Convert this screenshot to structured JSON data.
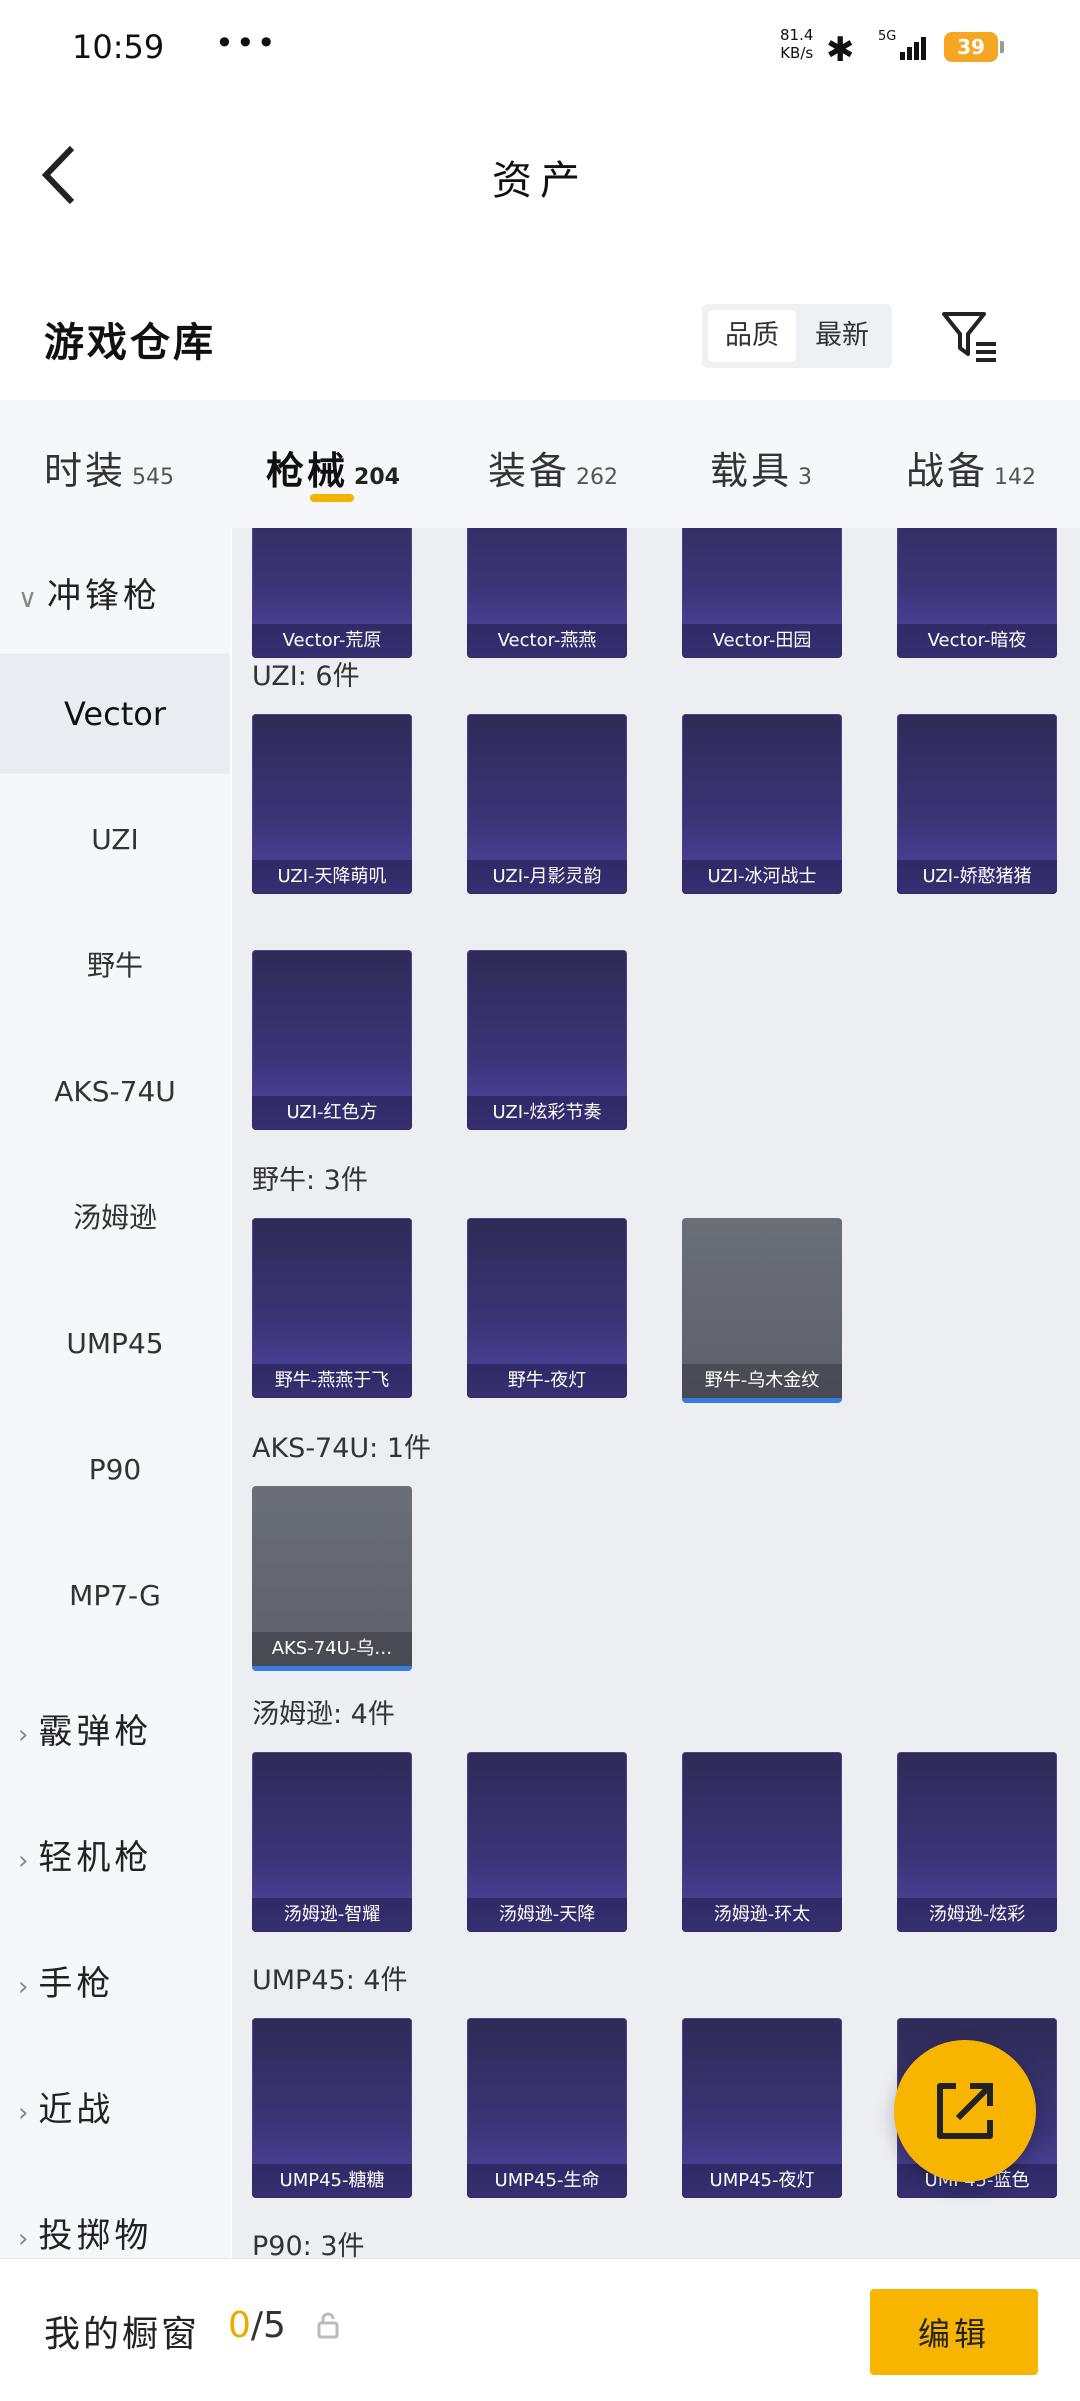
{
  "status_bar": {
    "time": "10:59",
    "net_speed": "81.4",
    "net_unit": "KB/s",
    "signal": "5G",
    "battery": "39"
  },
  "header": {
    "title": "资产"
  },
  "section": {
    "title": "游戏仓库",
    "sort_options": [
      "品质",
      "最新"
    ],
    "active_sort": "品质"
  },
  "tabs": [
    {
      "label": "时装",
      "count": "545"
    },
    {
      "label": "枪械",
      "count": "204"
    },
    {
      "label": "装备",
      "count": "262"
    },
    {
      "label": "载具",
      "count": "3"
    },
    {
      "label": "战备",
      "count": "142"
    }
  ],
  "sidebar": {
    "open_group": "冲锋枪",
    "items": [
      "Vector",
      "UZI",
      "野牛",
      "AKS-74U",
      "汤姆逊",
      "UMP45",
      "P90",
      "MP7-G"
    ],
    "collapsed_groups": [
      "霰弹枪",
      "轻机枪",
      "手枪",
      "近战",
      "投掷物"
    ]
  },
  "groups": {
    "vector": {
      "items": [
        "Vector-荒原",
        "Vector-燕燕",
        "Vector-田园",
        "Vector-暗夜"
      ]
    },
    "uzi": {
      "label": "UZI: 6件",
      "items": [
        "UZI-天降萌叽",
        "UZI-月影灵韵",
        "UZI-冰河战士",
        "UZI-娇憨猪猪",
        "UZI-红色方",
        "UZI-炫彩节奏"
      ]
    },
    "bison": {
      "label": "野牛: 3件",
      "items": [
        "野牛-燕燕于飞",
        "野牛-夜灯",
        "野牛-乌木金纹"
      ]
    },
    "aks": {
      "label": "AKS-74U: 1件",
      "items": [
        "AKS-74U-乌…"
      ]
    },
    "thompson": {
      "label": "汤姆逊: 4件",
      "items": [
        "汤姆逊-智耀",
        "汤姆逊-天降",
        "汤姆逊-环太",
        "汤姆逊-炫彩"
      ]
    },
    "ump": {
      "label": "UMP45: 4件",
      "items": [
        "UMP45-糖糖",
        "UMP45-生命",
        "UMP45-夜灯",
        "UMP45-蓝色"
      ]
    },
    "p90": {
      "label": "P90: 3件"
    }
  },
  "bottom_bar": {
    "label": "我的橱窗",
    "current": "0",
    "total": "/5",
    "edit_button": "编辑"
  },
  "colors": {
    "accent": "#f7b500",
    "card_bg": "#3b3478"
  }
}
